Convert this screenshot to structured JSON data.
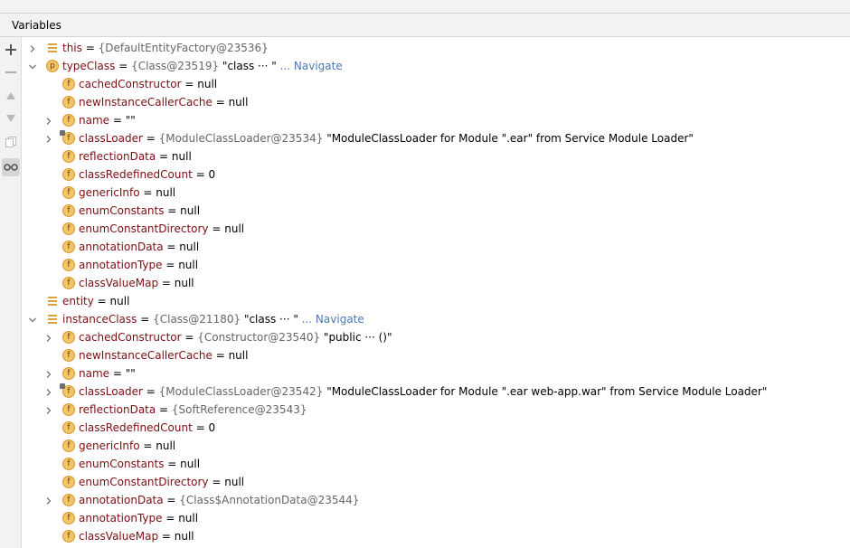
{
  "panel": {
    "title": "Variables"
  },
  "toolbar": {
    "buttons": [
      {
        "name": "add-watch-button",
        "icon": "plus-icon",
        "glyph": "+"
      },
      {
        "name": "remove-watch-button",
        "icon": "minus-icon",
        "glyph": "−"
      },
      {
        "name": "move-up-button",
        "icon": "triangle-up-icon",
        "glyph": "▲"
      },
      {
        "name": "move-down-button",
        "icon": "triangle-down-icon",
        "glyph": "▼"
      },
      {
        "name": "copy-button",
        "icon": "copy-icon",
        "glyph": ""
      },
      {
        "name": "show-watches-button",
        "icon": "glasses-icon",
        "glyph": ""
      }
    ]
  },
  "rows": [
    {
      "level": 0,
      "arrow": "collapsed",
      "icon": "field-list",
      "name": "this",
      "type": "{DefaultEntityFactory@23536}",
      "str": "",
      "nav": ""
    },
    {
      "level": 0,
      "arrow": "expanded",
      "icon": "p",
      "name": "typeClass",
      "type": "{Class@23519}",
      "str": "\"class ··· \"",
      "nav": "... Navigate"
    },
    {
      "level": 1,
      "arrow": "",
      "icon": "f",
      "name": "cachedConstructor",
      "value": "null"
    },
    {
      "level": 1,
      "arrow": "",
      "icon": "f",
      "name": "newInstanceCallerCache",
      "value": "null"
    },
    {
      "level": 1,
      "arrow": "collapsed",
      "icon": "f",
      "name": "name",
      "str": "\"\""
    },
    {
      "level": 1,
      "arrow": "collapsed",
      "icon": "f-locked",
      "name": "classLoader",
      "type": "{ModuleClassLoader@23534}",
      "str": "\"ModuleClassLoader for Module \".ear\" from Service Module Loader\""
    },
    {
      "level": 1,
      "arrow": "",
      "icon": "f",
      "name": "reflectionData",
      "value": "null"
    },
    {
      "level": 1,
      "arrow": "",
      "icon": "f",
      "name": "classRedefinedCount",
      "value": "0"
    },
    {
      "level": 1,
      "arrow": "",
      "icon": "f",
      "name": "genericInfo",
      "value": "null"
    },
    {
      "level": 1,
      "arrow": "",
      "icon": "f",
      "name": "enumConstants",
      "value": "null"
    },
    {
      "level": 1,
      "arrow": "",
      "icon": "f",
      "name": "enumConstantDirectory",
      "value": "null"
    },
    {
      "level": 1,
      "arrow": "",
      "icon": "f",
      "name": "annotationData",
      "value": "null"
    },
    {
      "level": 1,
      "arrow": "",
      "icon": "f",
      "name": "annotationType",
      "value": "null"
    },
    {
      "level": 1,
      "arrow": "",
      "icon": "f",
      "name": "classValueMap",
      "value": "null"
    },
    {
      "level": 0,
      "arrow": "",
      "icon": "field-list",
      "name": "entity",
      "value": "null"
    },
    {
      "level": 0,
      "arrow": "expanded",
      "icon": "field-list",
      "name": "instanceClass",
      "type": "{Class@21180}",
      "str": "\"class ··· \"",
      "nav": "... Navigate"
    },
    {
      "level": 1,
      "arrow": "collapsed",
      "icon": "f",
      "name": "cachedConstructor",
      "type": "{Constructor@23540}",
      "str": "\"public ··· ()\""
    },
    {
      "level": 1,
      "arrow": "",
      "icon": "f",
      "name": "newInstanceCallerCache",
      "value": "null"
    },
    {
      "level": 1,
      "arrow": "collapsed",
      "icon": "f",
      "name": "name",
      "str": "\"\""
    },
    {
      "level": 1,
      "arrow": "collapsed",
      "icon": "f-locked",
      "name": "classLoader",
      "type": "{ModuleClassLoader@23542}",
      "str": "\"ModuleClassLoader for Module \".ear web-app.war\" from Service Module Loader\""
    },
    {
      "level": 1,
      "arrow": "collapsed",
      "icon": "f",
      "name": "reflectionData",
      "type": "{SoftReference@23543}"
    },
    {
      "level": 1,
      "arrow": "",
      "icon": "f",
      "name": "classRedefinedCount",
      "value": "0"
    },
    {
      "level": 1,
      "arrow": "",
      "icon": "f",
      "name": "genericInfo",
      "value": "null"
    },
    {
      "level": 1,
      "arrow": "",
      "icon": "f",
      "name": "enumConstants",
      "value": "null"
    },
    {
      "level": 1,
      "arrow": "",
      "icon": "f",
      "name": "enumConstantDirectory",
      "value": "null"
    },
    {
      "level": 1,
      "arrow": "collapsed",
      "icon": "f",
      "name": "annotationData",
      "type": "{Class$AnnotationData@23544}"
    },
    {
      "level": 1,
      "arrow": "",
      "icon": "f",
      "name": "annotationType",
      "value": "null"
    },
    {
      "level": 1,
      "arrow": "",
      "icon": "f",
      "name": "classValueMap",
      "value": "null"
    }
  ]
}
